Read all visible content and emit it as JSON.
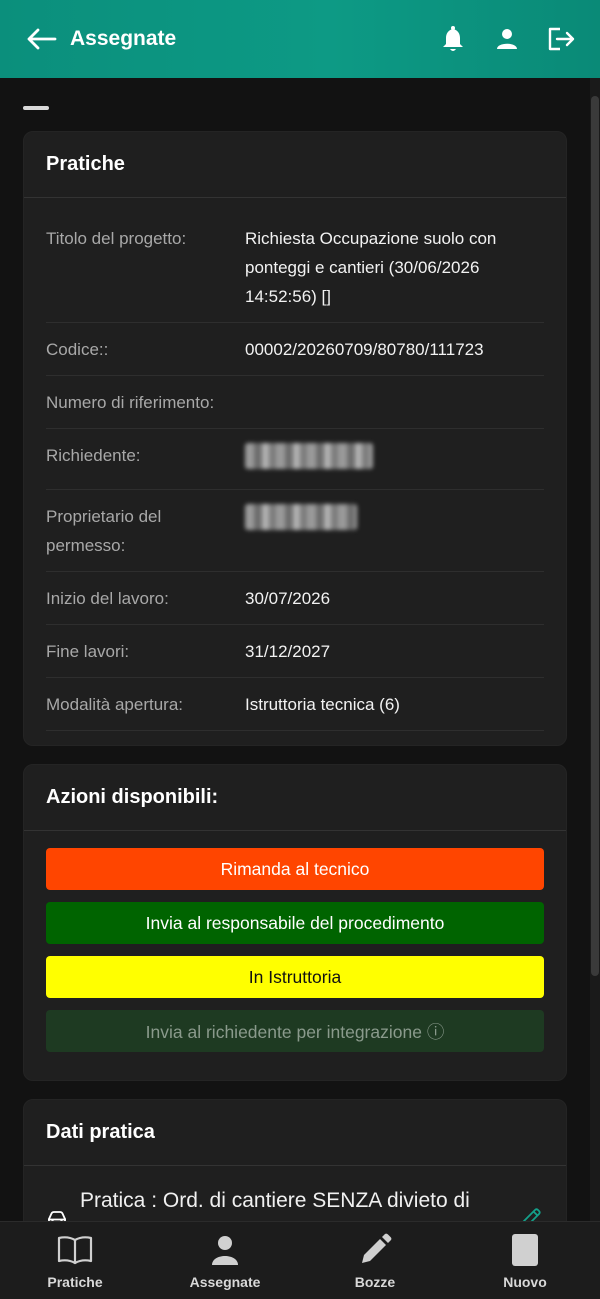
{
  "header": {
    "title": "Assegnate",
    "icons": [
      "arrow-left-icon",
      "bell-icon",
      "user-icon",
      "logout-icon"
    ]
  },
  "pratiche": {
    "heading": "Pratiche",
    "rows": [
      {
        "label": "Titolo del progetto:",
        "value": "Richiesta Occupazione suolo con ponteggi e cantieri (30/06/2026 14:52:56) []"
      },
      {
        "label": "Codice::",
        "value": "00002/20260709/80780/111723"
      },
      {
        "label": "Numero di riferimento:",
        "value": ""
      },
      {
        "label": "Richiedente:",
        "value": ""
      },
      {
        "label": "Proprietario del permesso:",
        "value": ""
      },
      {
        "label": "Inizio del lavoro:",
        "value": "30/07/2026"
      },
      {
        "label": "Fine lavori:",
        "value": "31/12/2027"
      },
      {
        "label": "Modalità apertura:",
        "value": "Istruttoria tecnica (6)"
      }
    ]
  },
  "azioni": {
    "heading": "Azioni disponibili:",
    "buttons": [
      {
        "label": "Rimanda al tecnico",
        "color": "#ff4500"
      },
      {
        "label": "Invia al responsabile del procedimento",
        "color": "#006400"
      },
      {
        "label": "In Istruttoria",
        "color": "#ffff00"
      },
      {
        "label": "Invia al richiedente per integrazione ⓘ",
        "color": "#1e3a22",
        "disabled": true
      }
    ]
  },
  "dati": {
    "heading": "Dati pratica",
    "pratica_text": "Pratica : Ord. di cantiere SENZA divieto di transito veicolare"
  },
  "nav": {
    "items": [
      {
        "label": "Pratiche",
        "icon": "book-icon"
      },
      {
        "label": "Assegnate",
        "icon": "person-icon"
      },
      {
        "label": "Bozze",
        "icon": "pencil-icon"
      },
      {
        "label": "Nuovo",
        "icon": "document-icon"
      }
    ]
  },
  "colors": {
    "accent": "#0d9a85",
    "edit_icon": "#14a08a"
  }
}
